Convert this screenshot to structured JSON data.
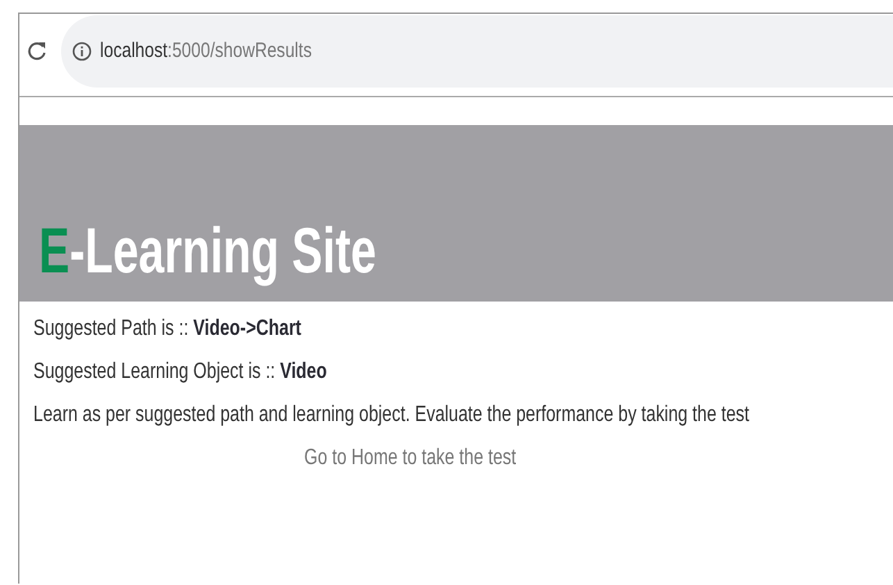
{
  "browser": {
    "host": "localhost",
    "path": ":5000/showResults"
  },
  "header": {
    "accent": "E",
    "rest": "-Learning Site"
  },
  "lines": [
    "Suggested Path is :: **Video->Chart**",
    "Suggested Learning Object is :: **Video**",
    "Learn as per suggested path and learning object. Evaluate the performance by taking the test"
  ],
  "link": "Go to Home to take the test"
}
